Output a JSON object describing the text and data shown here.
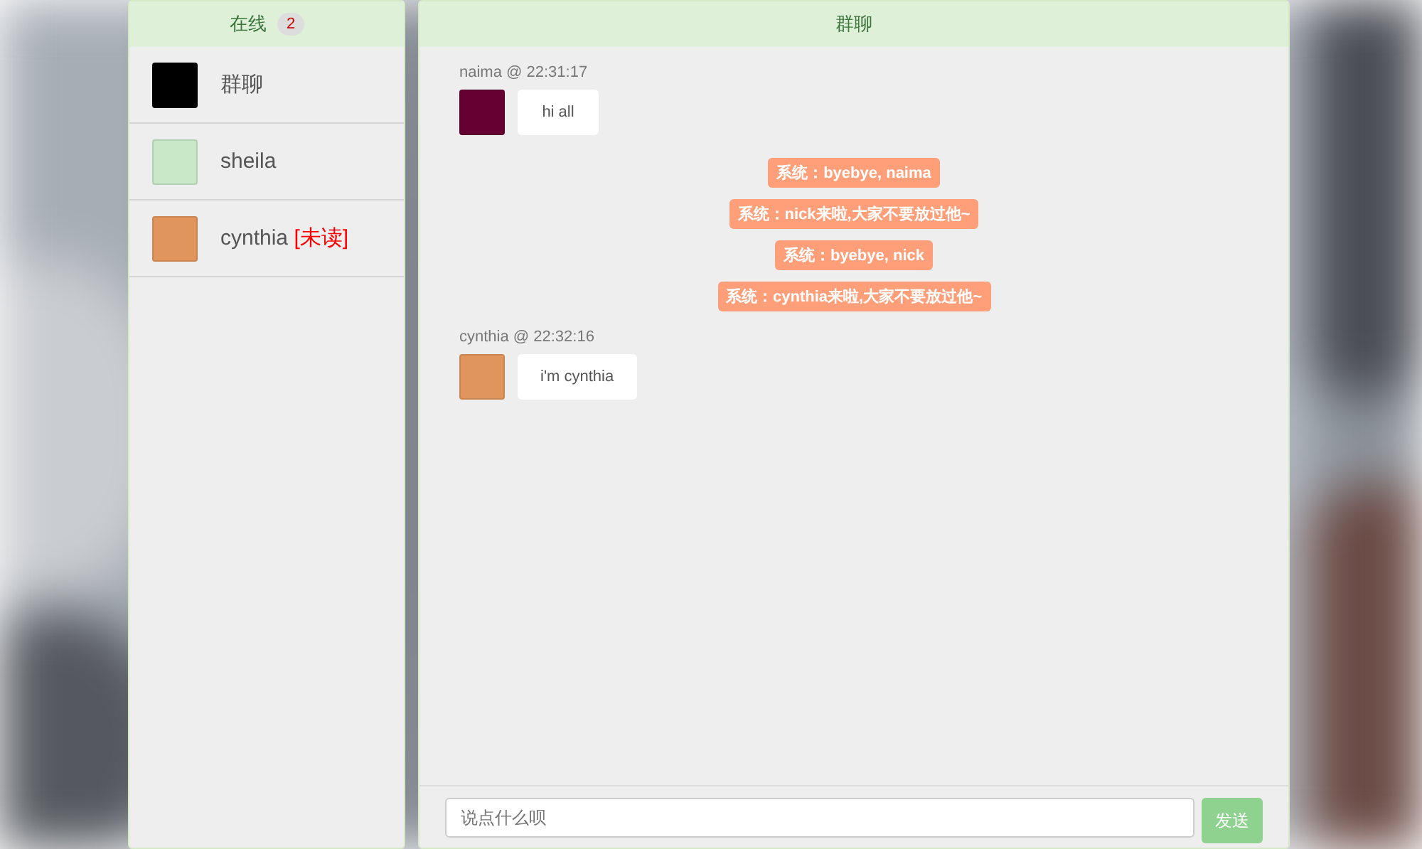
{
  "sidebar": {
    "title": "在线",
    "count": "2",
    "items": [
      {
        "name": "群聊",
        "color": "#000000"
      },
      {
        "name": "sheila",
        "color": "#c8e8c8"
      },
      {
        "name": "cynthia",
        "color": "#e0955c",
        "unread": "[未读]"
      }
    ]
  },
  "chat": {
    "title": "群聊",
    "messages": [
      {
        "kind": "user",
        "header": "naima @ 22:31:17",
        "color": "#660033",
        "text": "hi all"
      },
      {
        "kind": "system",
        "text": "系统：byebye, naima"
      },
      {
        "kind": "system",
        "text": "系统：nick来啦,大家不要放过他~"
      },
      {
        "kind": "system",
        "text": "系统：byebye, nick"
      },
      {
        "kind": "system",
        "text": "系统：cynthia来啦,大家不要放过他~"
      },
      {
        "kind": "user",
        "header": "cynthia @ 22:32:16",
        "color": "#e0955c",
        "text": "i'm cynthia"
      }
    ],
    "input": {
      "placeholder": "说点什么呗"
    },
    "send": "发送"
  }
}
